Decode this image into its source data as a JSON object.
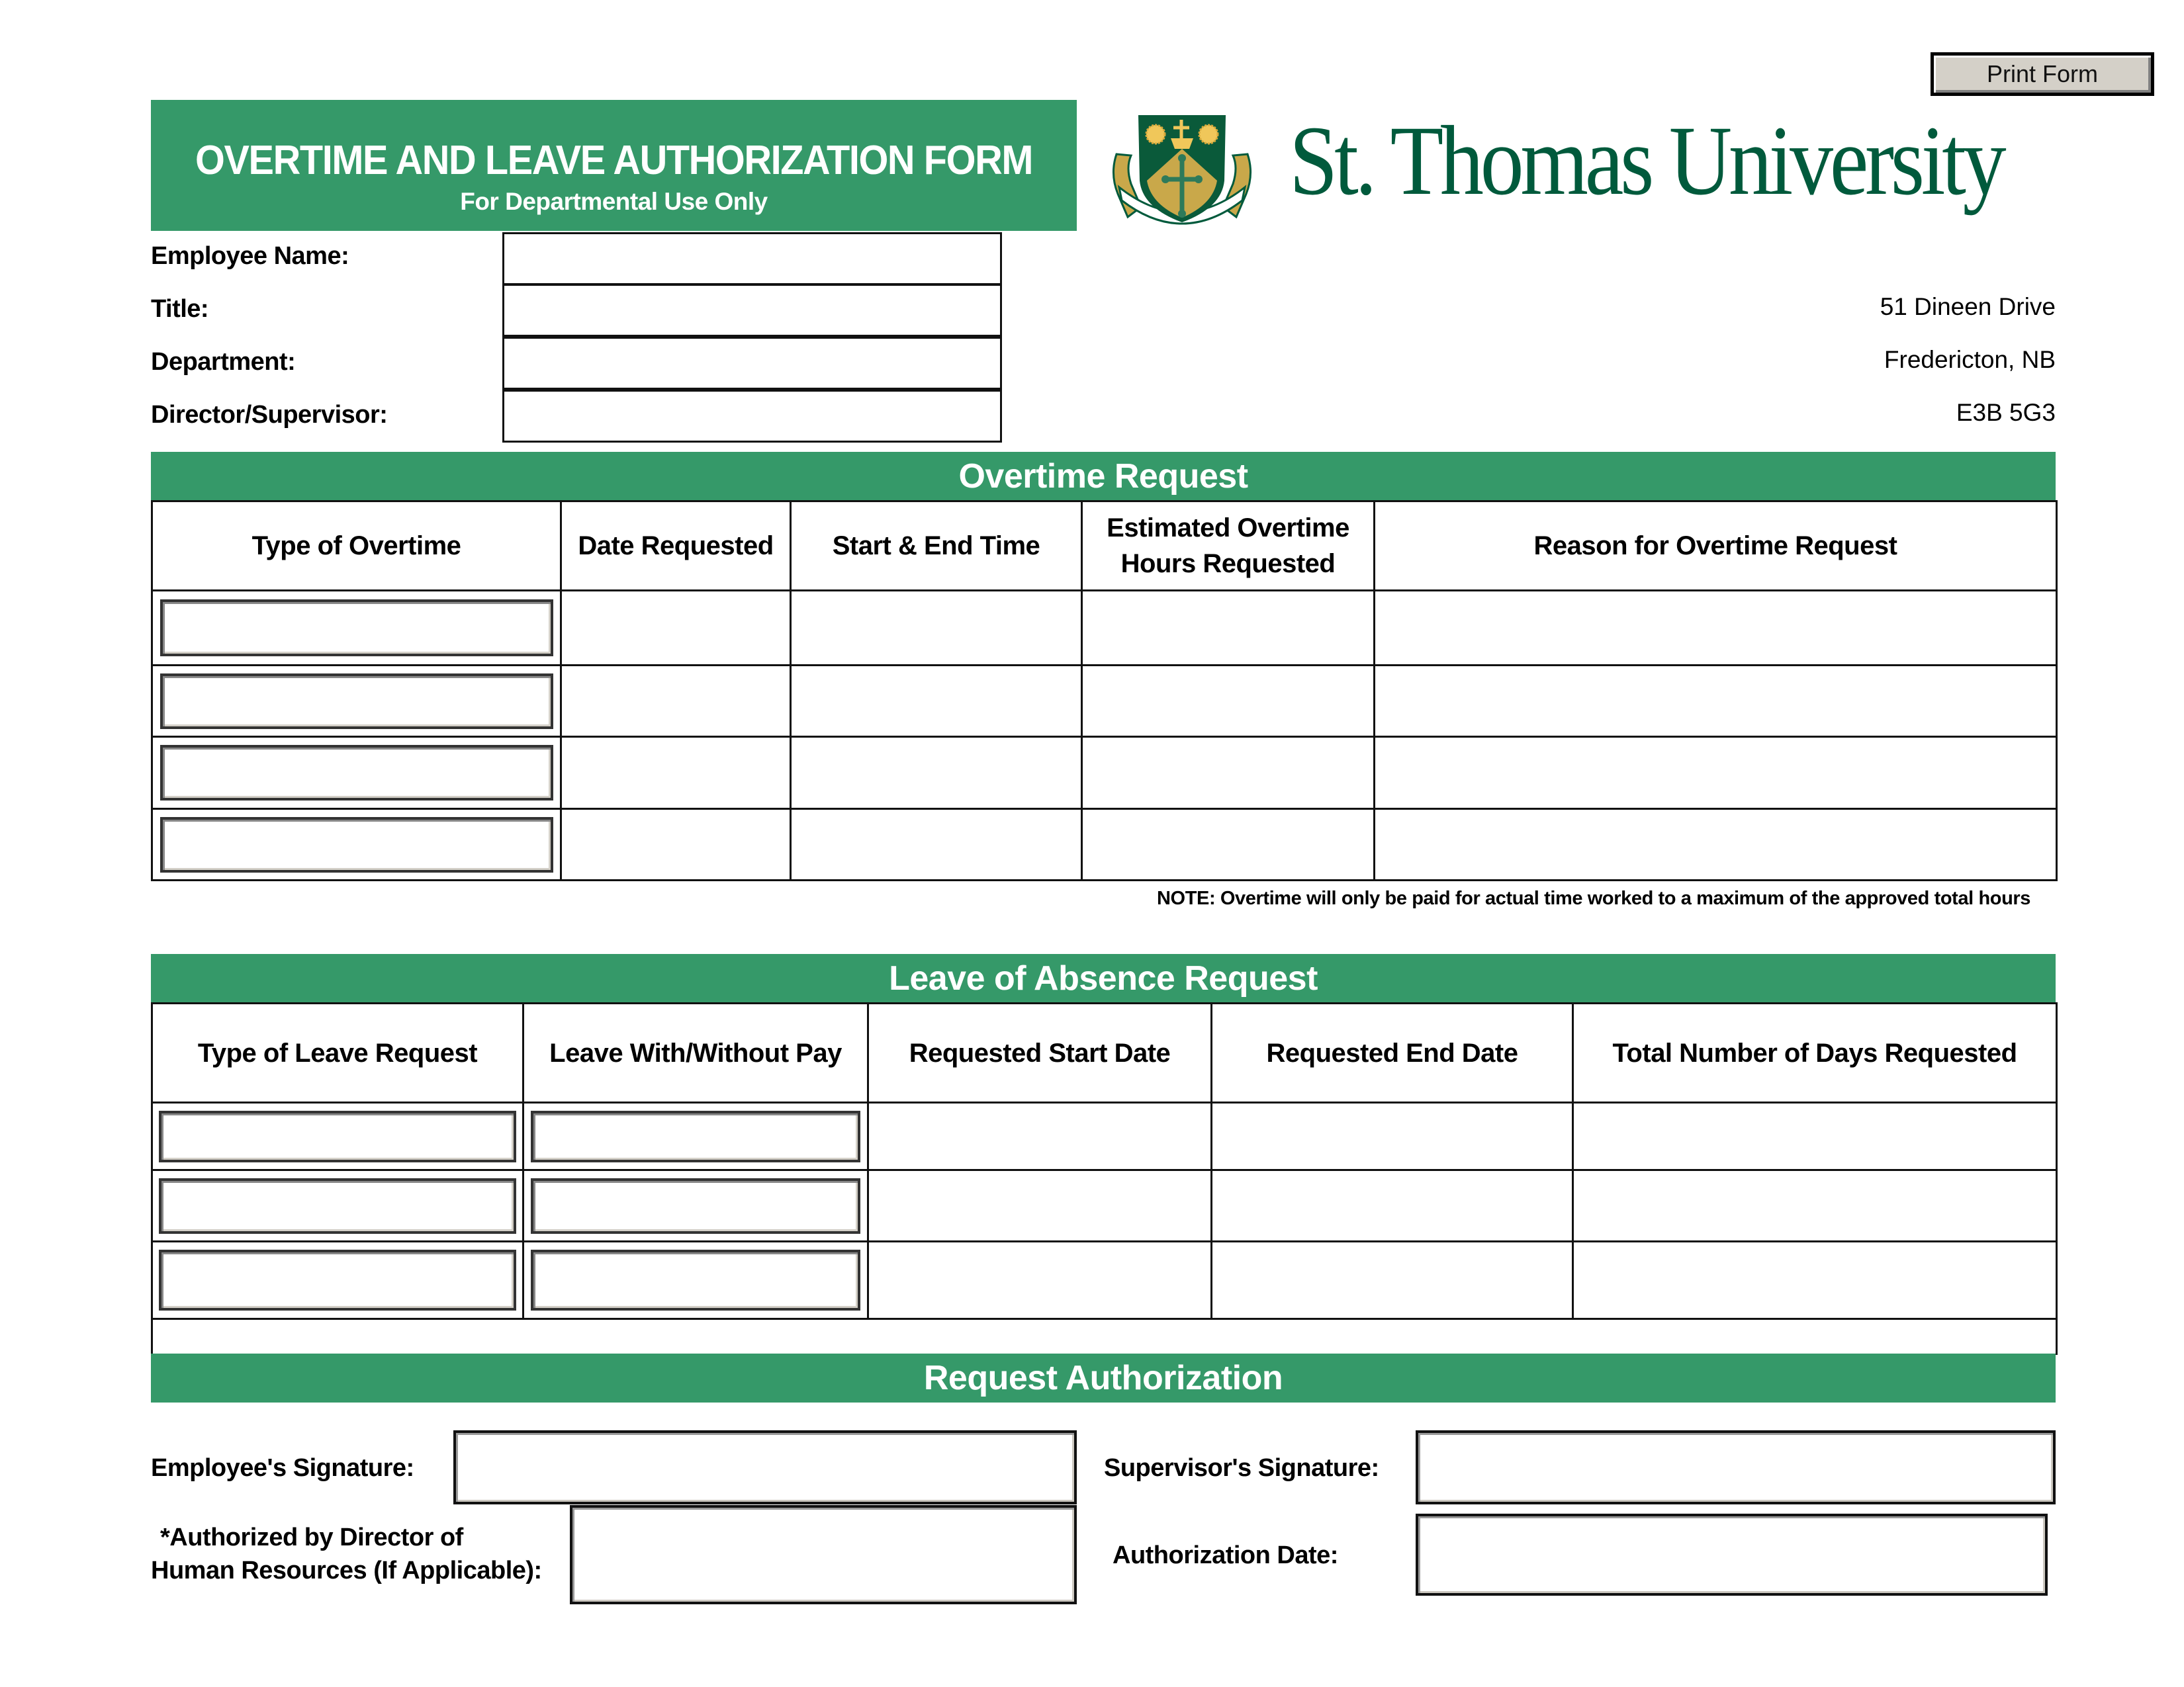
{
  "print_button": {
    "label": "Print Form"
  },
  "header": {
    "title": "OVERTIME AND LEAVE AUTHORIZATION FORM",
    "subtitle": "For Departmental Use Only",
    "university_name": "St. Thomas University",
    "address": [
      "51 Dineen Drive",
      "Fredericton, NB",
      "E3B 5G3"
    ],
    "brand_colors": {
      "section_green": "#359969",
      "logo_green": "#005a3c",
      "logo_gold": "#c9a84a"
    }
  },
  "employee_fields": [
    {
      "label": "Employee Name:",
      "value": ""
    },
    {
      "label": "Title:",
      "value": ""
    },
    {
      "label": "Department:",
      "value": ""
    },
    {
      "label": "Director/Supervisor:",
      "value": ""
    }
  ],
  "overtime": {
    "section_title": "Overtime Request",
    "columns": [
      "Type of Overtime",
      "Date Requested",
      "Start & End Time",
      "Estimated Overtime Hours Requested",
      "Reason for Overtime Request"
    ],
    "rows": [
      {
        "type": "",
        "date": "",
        "time": "",
        "hours": "",
        "reason": ""
      },
      {
        "type": "",
        "date": "",
        "time": "",
        "hours": "",
        "reason": ""
      },
      {
        "type": "",
        "date": "",
        "time": "",
        "hours": "",
        "reason": ""
      },
      {
        "type": "",
        "date": "",
        "time": "",
        "hours": "",
        "reason": ""
      }
    ],
    "note": "NOTE: Overtime will only be paid for actual time worked to a maximum of the approved total hours"
  },
  "leave": {
    "section_title": "Leave of Absence Request",
    "columns": [
      "Type of Leave Request",
      "Leave With/Without Pay",
      "Requested Start Date",
      "Requested End Date",
      "Total Number of Days Requested"
    ],
    "rows": [
      {
        "type": "",
        "pay": "",
        "start": "",
        "end": "",
        "days": ""
      },
      {
        "type": "",
        "pay": "",
        "start": "",
        "end": "",
        "days": ""
      },
      {
        "type": "",
        "pay": "",
        "start": "",
        "end": "",
        "days": ""
      }
    ]
  },
  "authorization": {
    "section_title": "Request Authorization",
    "employee_signature_label": "Employee's Signature:",
    "hr_label_line1": "*Authorized by Director of",
    "hr_label_line2": "Human Resources (If Applicable):",
    "supervisor_signature_label": "Supervisor's Signature:",
    "authorization_date_label": "Authorization Date:",
    "employee_signature": "",
    "hr_signature": "",
    "supervisor_signature": "",
    "authorization_date": ""
  }
}
